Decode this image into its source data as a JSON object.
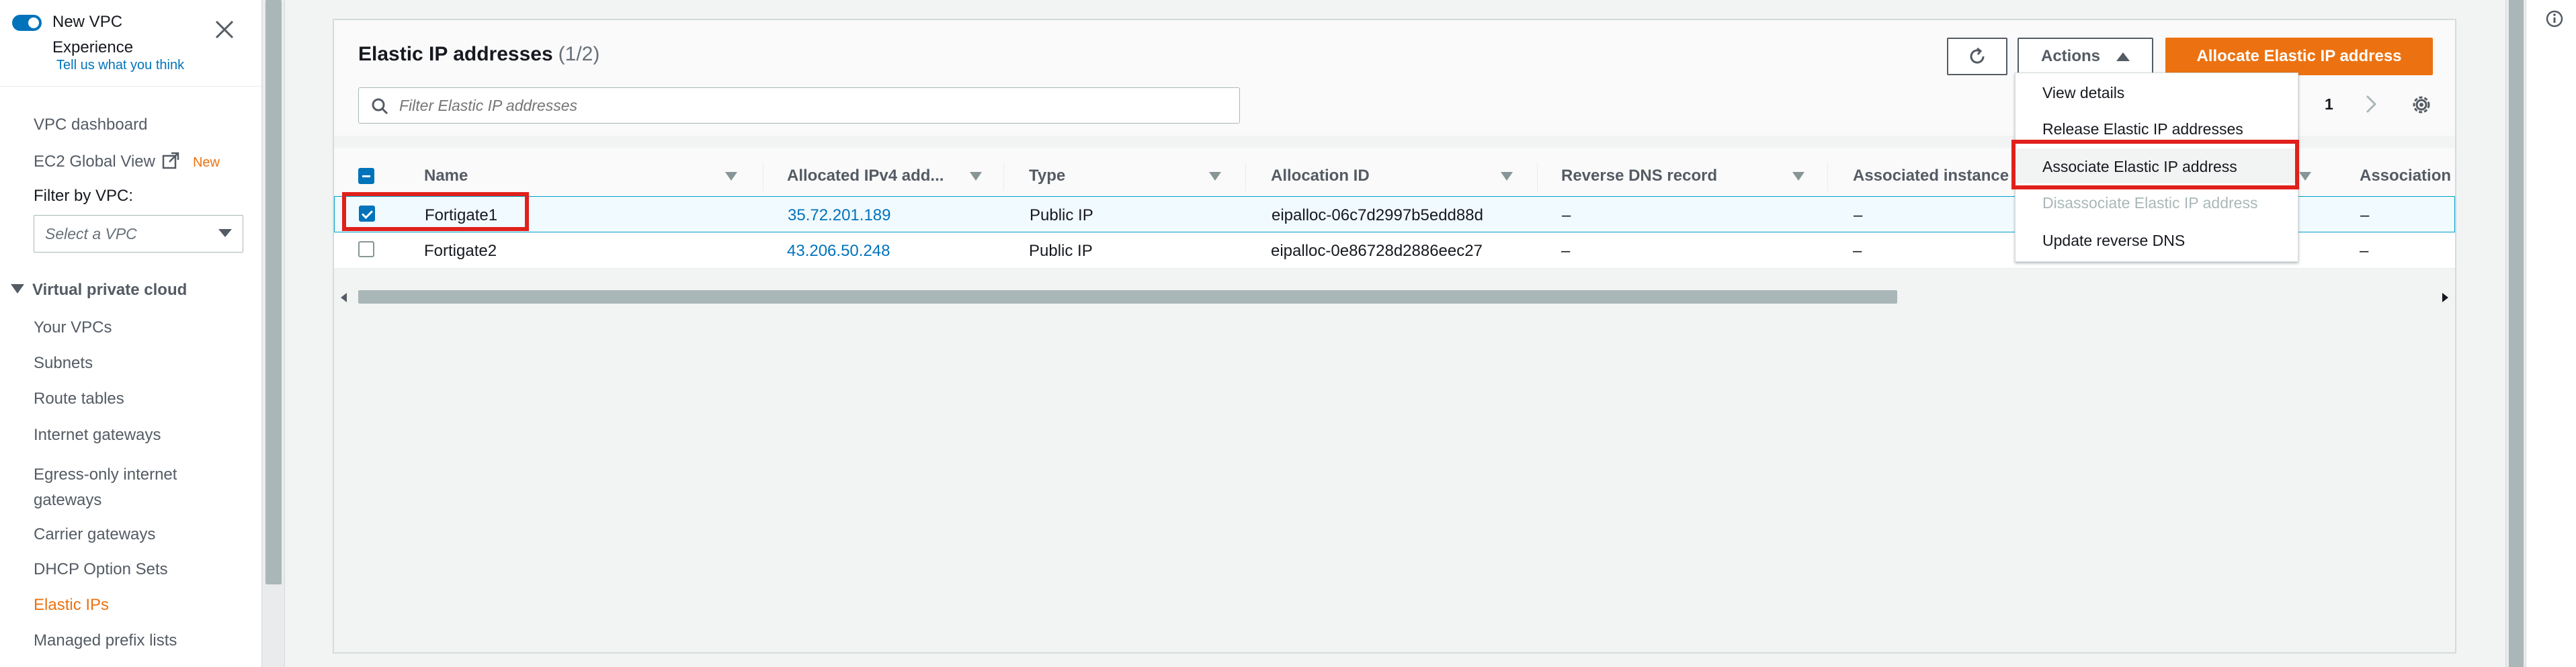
{
  "sidebar": {
    "new_vpc_title": "New VPC Experience",
    "tell_us_link": "Tell us what you think",
    "items_top": [
      {
        "label": "VPC dashboard"
      },
      {
        "label": "EC2 Global View",
        "badge": "New"
      }
    ],
    "filter_label": "Filter by VPC:",
    "filter_placeholder": "Select a VPC",
    "section_title": "Virtual private cloud",
    "items": [
      {
        "label": "Your VPCs"
      },
      {
        "label": "Subnets"
      },
      {
        "label": "Route tables"
      },
      {
        "label": "Internet gateways"
      },
      {
        "label": "Egress-only internet gateways"
      },
      {
        "label": "Carrier gateways"
      },
      {
        "label": "DHCP Option Sets"
      },
      {
        "label": "Elastic IPs",
        "active": true
      },
      {
        "label": "Managed prefix lists"
      }
    ]
  },
  "panel": {
    "title": "Elastic IP addresses",
    "count": "(1/2)",
    "search_placeholder": "Filter Elastic IP addresses",
    "actions_label": "Actions",
    "allocate_label": "Allocate Elastic IP address",
    "page_number": "1"
  },
  "table": {
    "columns": [
      "Name",
      "Allocated IPv4 add...",
      "Type",
      "Allocation ID",
      "Reverse DNS record",
      "Associated instance",
      "Association"
    ],
    "rows": [
      {
        "selected": true,
        "name": "Fortigate1",
        "ip": "35.72.201.189",
        "type": "Public IP",
        "allocation_id": "eipalloc-06c7d2997b5edd88d",
        "reverse_dns": "–",
        "instance": "–",
        "association": "–"
      },
      {
        "selected": false,
        "name": "Fortigate2",
        "ip": "43.206.50.248",
        "type": "Public IP",
        "allocation_id": "eipalloc-0e86728d2886eec27",
        "reverse_dns": "–",
        "instance": "–",
        "association": "–"
      }
    ]
  },
  "actions_menu": {
    "items": [
      {
        "label": "View details",
        "enabled": true
      },
      {
        "label": "Release Elastic IP addresses",
        "enabled": true
      },
      {
        "label": "Associate Elastic IP address",
        "enabled": true,
        "highlighted": true
      },
      {
        "label": "Disassociate Elastic IP address",
        "enabled": false
      },
      {
        "label": "Update reverse DNS",
        "enabled": true
      }
    ]
  },
  "colors": {
    "accent_orange": "#ec7211",
    "link_blue": "#0073bb",
    "highlight_red": "#e0201b"
  }
}
